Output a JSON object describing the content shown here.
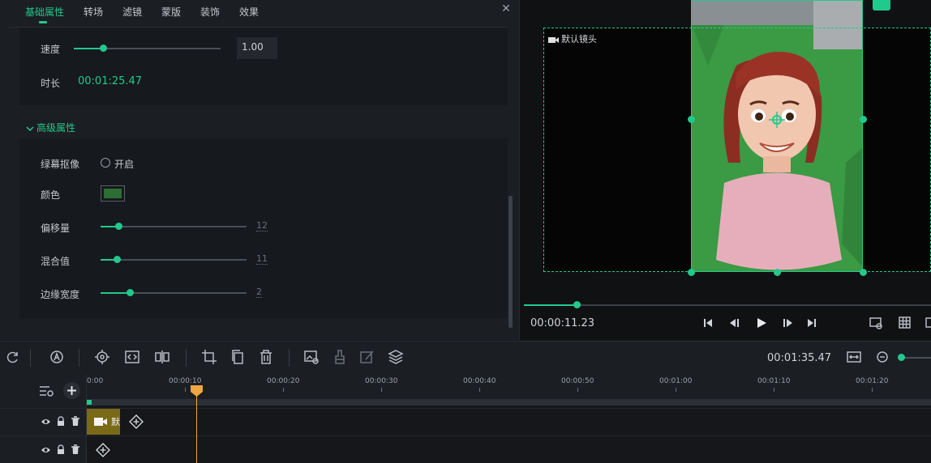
{
  "tabs": [
    "基础属性",
    "转场",
    "滤镜",
    "蒙版",
    "装饰",
    "效果"
  ],
  "close_icon": "close-icon",
  "basic": {
    "speed_label": "速度",
    "speed_value": "1.00",
    "speed_fraction": 0.2,
    "duration_label": "时长",
    "duration_value": "00:01:25.47"
  },
  "advanced": {
    "header": "高级属性",
    "chroma_label": "绿幕抠像",
    "chroma_toggle_label": "开启",
    "color_label": "颜色",
    "color_swatch": "#2c6e33",
    "offset_label": "偏移量",
    "offset_value": "12",
    "offset_fraction": 0.12,
    "blend_label": "混合值",
    "blend_value": "11",
    "blend_fraction": 0.11,
    "edge_label": "边缘宽度",
    "edge_value": "2",
    "edge_fraction": 0.2
  },
  "preview": {
    "camera_label": "默认镜头",
    "current_time": "00:00:11.23",
    "progress_fraction": 0.13
  },
  "toolbar": {
    "total_time": "00:01:35.47"
  },
  "timeline": {
    "ticks": [
      "0:00",
      "00:00:10",
      "00:00:20",
      "00:00:30",
      "00:00:40",
      "00:00:50",
      "00:01:00",
      "00:01:10",
      "00:01:20"
    ],
    "clip_label": "默",
    "playhead_time": "00:00:11.23"
  },
  "colors": {
    "accent": "#22c98c",
    "playhead": "#f0a742",
    "clip": "#7a6a18",
    "green_screen": "#3b9a44"
  }
}
